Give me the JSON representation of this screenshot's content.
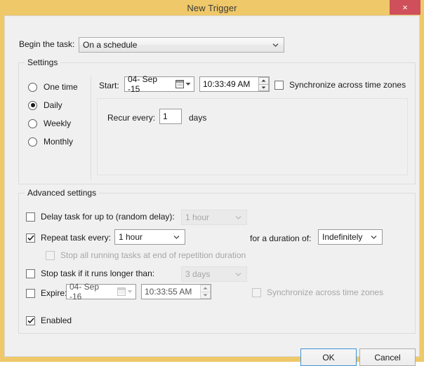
{
  "window": {
    "title": "New Trigger",
    "close_label": "×",
    "accent_gold": "#efc869",
    "close_red": "#cf4f5b",
    "focus_blue": "#3c93d8"
  },
  "begin_task": {
    "label": "Begin the task:",
    "value": "On a schedule",
    "icon": "chevron-down-icon"
  },
  "settings": {
    "legend": "Settings",
    "schedule_options": [
      {
        "label": "One time",
        "selected": false
      },
      {
        "label": "Daily",
        "selected": true
      },
      {
        "label": "Weekly",
        "selected": false
      },
      {
        "label": "Monthly",
        "selected": false
      }
    ],
    "start": {
      "label": "Start:",
      "date": "04- Sep -15",
      "time": "10:33:49 AM",
      "date_icon": "calendar-icon"
    },
    "sync_time_zones": {
      "label": "Synchronize across time zones",
      "checked": false,
      "enabled": true
    },
    "recur": {
      "label": "Recur every:",
      "value": "1",
      "unit": "days"
    }
  },
  "advanced": {
    "legend": "Advanced settings",
    "delay_task": {
      "label": "Delay task for up to (random delay):",
      "checked": false,
      "value": "1 hour",
      "enabled": false
    },
    "repeat_task": {
      "label": "Repeat task every:",
      "checked": true,
      "value": "1 hour",
      "enabled": true
    },
    "duration": {
      "label": "for a duration of:",
      "value": "Indefinitely",
      "enabled": true
    },
    "stop_all_running": {
      "label": "Stop all running tasks at end of repetition duration",
      "checked": false,
      "enabled": false
    },
    "stop_task_longer": {
      "label": "Stop task if it runs longer than:",
      "checked": false,
      "value": "3 days",
      "enabled": false
    },
    "expire": {
      "label": "Expire:",
      "checked": false,
      "date": "04- Sep -16",
      "time": "10:33:55 AM",
      "enabled": false
    },
    "expire_sync_time_zones": {
      "label": "Synchronize across time zones",
      "checked": false,
      "enabled": false
    },
    "enabled_option": {
      "label": "Enabled",
      "checked": true
    }
  },
  "footer": {
    "ok_label": "OK",
    "cancel_label": "Cancel"
  }
}
